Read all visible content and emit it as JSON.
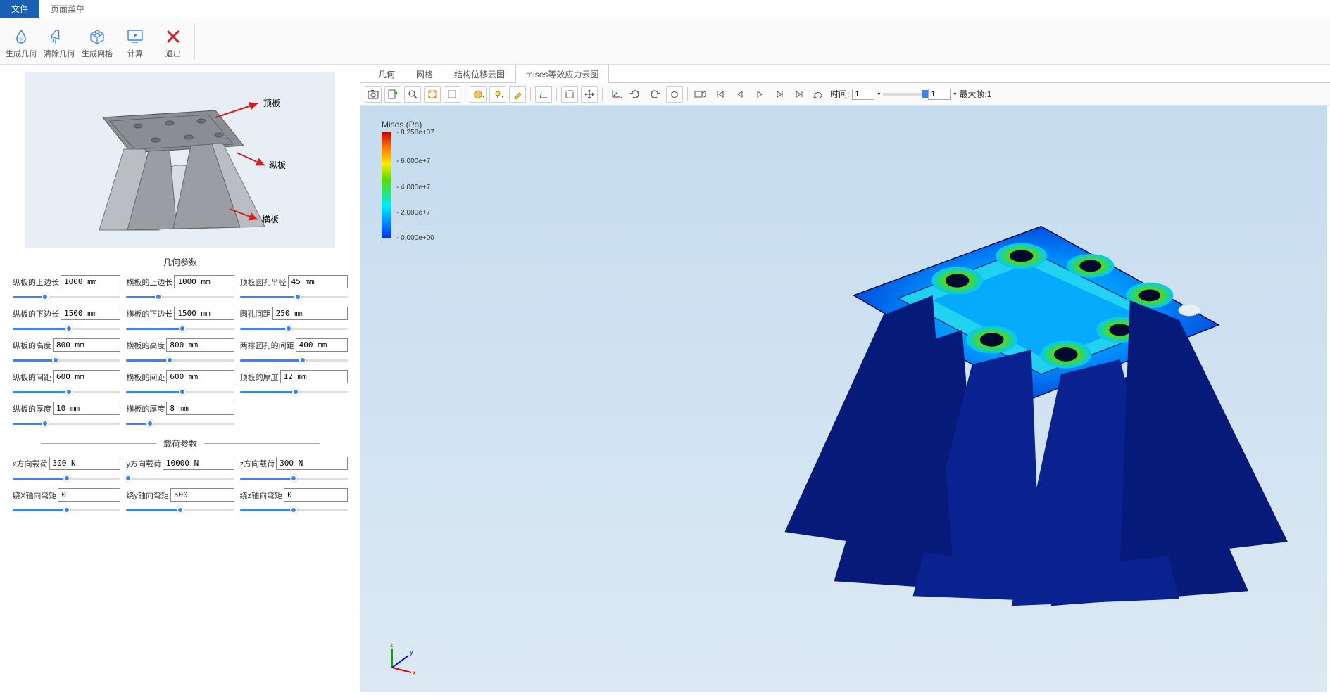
{
  "menubar": {
    "tabs": [
      {
        "label": "文件",
        "active": true
      },
      {
        "label": "页面菜单",
        "active": false
      }
    ]
  },
  "ribbon": {
    "buttons": [
      {
        "label": "生成几何",
        "iconColor": "#3b82f6"
      },
      {
        "label": "清除几何",
        "iconColor": "#3b82f6"
      },
      {
        "label": "生成网格",
        "iconColor": "#3b82f6"
      },
      {
        "label": "计算",
        "iconColor": "#3b82f6"
      },
      {
        "label": "退出",
        "iconColor": "#d02020"
      }
    ]
  },
  "diagram": {
    "annotations": [
      "顶板",
      "纵板",
      "横板"
    ]
  },
  "sections": {
    "geometry": "几何参数",
    "load": "载荷参数"
  },
  "geom_params": [
    {
      "label": "纵板的上边长",
      "value": "1000 mm",
      "pct": 30
    },
    {
      "label": "横板的上边长",
      "value": "1000 mm",
      "pct": 30
    },
    {
      "label": "顶板圆孔半径",
      "value": "45 mm",
      "pct": 54
    },
    {
      "label": "纵板的下边长",
      "value": "1500 mm",
      "pct": 52
    },
    {
      "label": "横板的下边长",
      "value": "1500 mm",
      "pct": 52
    },
    {
      "label": "圆孔间距",
      "value": "250 mm",
      "pct": 45
    },
    {
      "label": "纵板的高度",
      "value": "800 mm",
      "pct": 40
    },
    {
      "label": "横板的高度",
      "value": "800 mm",
      "pct": 40
    },
    {
      "label": "两排圆孔的间距",
      "value": "400 mm",
      "pct": 58
    },
    {
      "label": "纵板的间距",
      "value": "600 mm",
      "pct": 52
    },
    {
      "label": "横板的间距",
      "value": "600 mm",
      "pct": 52
    },
    {
      "label": "顶板的厚度",
      "value": "12 mm",
      "pct": 52
    },
    {
      "label": "纵板的厚度",
      "value": "10 mm",
      "pct": 30
    },
    {
      "label": "横板的厚度",
      "value": "8 mm",
      "pct": 22
    }
  ],
  "load_params": [
    {
      "label": "x方向载荷",
      "value": "300 N",
      "pct": 50
    },
    {
      "label": "y方向载荷",
      "value": "10000 N",
      "pct": 2
    },
    {
      "label": "z方向载荷",
      "value": "300 N",
      "pct": 50
    },
    {
      "label": "绕X轴向弯矩",
      "value": "0",
      "pct": 50
    },
    {
      "label": "绕y轴向弯矩",
      "value": "500",
      "pct": 50
    },
    {
      "label": "绕z轴向弯矩",
      "value": "0",
      "pct": 50
    }
  ],
  "view_tabs": [
    {
      "label": "几何",
      "active": false
    },
    {
      "label": "网格",
      "active": false
    },
    {
      "label": "结构位移云图",
      "active": false
    },
    {
      "label": "mises等效应力云图",
      "active": true
    }
  ],
  "legend": {
    "title": "Mises (Pa)",
    "ticks": [
      {
        "label": "8.258e+07",
        "pos": 0
      },
      {
        "label": "6.000e+7",
        "pos": 27
      },
      {
        "label": "4.000e+7",
        "pos": 52
      },
      {
        "label": "2.000e+7",
        "pos": 76
      },
      {
        "label": "0.000e+00",
        "pos": 100
      }
    ]
  },
  "timebar": {
    "time_label": "时间:",
    "time_value": "1",
    "frame_value": "1",
    "max_frame_label": "最大帧:1"
  }
}
